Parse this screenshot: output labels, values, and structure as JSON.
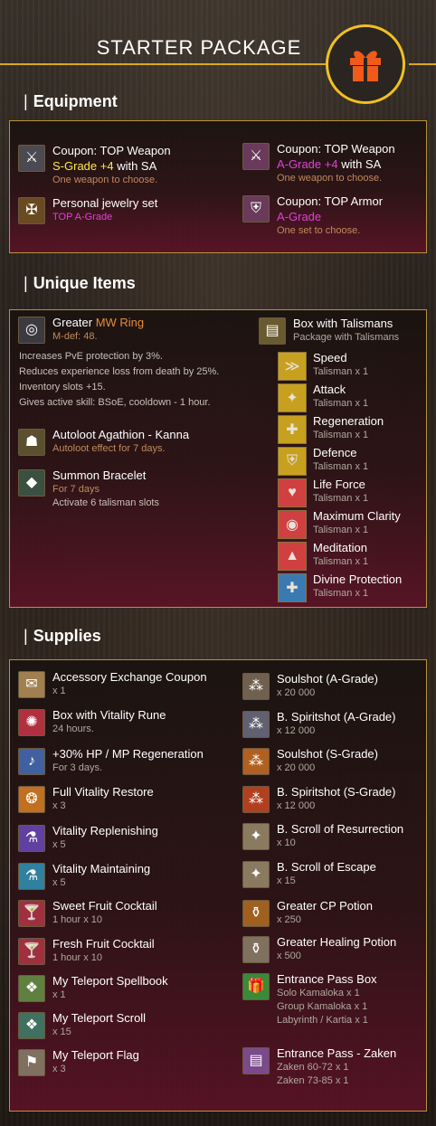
{
  "header": {
    "title": "STARTER PACKAGE"
  },
  "sections": {
    "equipment": "Equipment",
    "unique": "Unique Items",
    "supplies": "Supplies"
  },
  "equipment": [
    {
      "name": "Coupon: TOP Weapon",
      "grade": "S-Grade +4",
      "grade_suffix": " with SA",
      "note": "One weapon to choose.",
      "icon": "weapon-coupon-icon"
    },
    {
      "name": "Coupon: TOP Weapon",
      "grade": "A-Grade +4",
      "grade_suffix": " with SA",
      "note": "One weapon to choose.",
      "icon": "weapon-coupon-icon"
    },
    {
      "name": "Personal jewelry set",
      "grade": "TOP A-Grade",
      "icon": "jewelry-icon"
    },
    {
      "name": "Coupon: TOP Armor",
      "grade": "A-Grade",
      "note": "One set to choose.",
      "icon": "armor-coupon-icon"
    }
  ],
  "unique": {
    "ring": {
      "name": "Greater ",
      "name_hl": "MW Ring",
      "mdef": "M-def: 48.",
      "desc": [
        "Increases PvE protection by 3%.",
        "Reduces experience loss from death by 25%.",
        "Inventory slots +15.",
        "Gives active skill: BSoE, cooldown - 1 hour."
      ]
    },
    "agathion": {
      "name": "Autoloot Agathion - Kanna",
      "note": "Autoloot effect for 7 days."
    },
    "bracelet": {
      "name": "Summon Bracelet",
      "note": "For 7 days",
      "sub": "Activate 6 talisman slots"
    },
    "box": {
      "name": "Box with Talismans",
      "sub": "Package with Talismans"
    },
    "talismans": [
      {
        "name": "Speed",
        "qty": "Talisman x 1",
        "color": "#c8a020",
        "glyph": "≫"
      },
      {
        "name": "Attack",
        "qty": "Talisman x 1",
        "color": "#c8a020",
        "glyph": "✦"
      },
      {
        "name": "Regeneration",
        "qty": "Talisman x 1",
        "color": "#c8a020",
        "glyph": "✚"
      },
      {
        "name": "Defence",
        "qty": "Talisman x 1",
        "color": "#c8a020",
        "glyph": "⛨"
      },
      {
        "name": "Life Force",
        "qty": "Talisman x 1",
        "color": "#d04040",
        "glyph": "♥"
      },
      {
        "name": "Maximum Clarity",
        "qty": "Talisman x 1",
        "color": "#d04040",
        "glyph": "◉"
      },
      {
        "name": "Meditation",
        "qty": "Talisman x 1",
        "color": "#d04040",
        "glyph": "▲"
      },
      {
        "name": "Divine Protection",
        "qty": "Talisman x 1",
        "color": "#3a7ab0",
        "glyph": "✚"
      }
    ]
  },
  "supplies_left": [
    {
      "name": "Accessory Exchange Coupon",
      "qty": "x 1",
      "icon": "scroll-icon",
      "glyph": "✉",
      "color": "#a08050"
    },
    {
      "name": "Box with Vitality Rune",
      "qty": "24 hours.",
      "icon": "rune-icon",
      "glyph": "✺",
      "color": "#b03040"
    },
    {
      "name": "+30% HP / MP Regeneration",
      "qty": "For 3 days.",
      "icon": "regen-icon",
      "glyph": "♪",
      "color": "#4060a0"
    },
    {
      "name": "Full Vitality Restore",
      "qty": "x 3",
      "icon": "restore-icon",
      "glyph": "❂",
      "color": "#c07020"
    },
    {
      "name": "Vitality Replenishing",
      "qty": "x 5",
      "icon": "potion-icon",
      "glyph": "⚗",
      "color": "#6040a0"
    },
    {
      "name": "Vitality Maintaining",
      "qty": "x 5",
      "icon": "potion-icon",
      "glyph": "⚗",
      "color": "#3080a0"
    },
    {
      "name": "Sweet Fruit Cocktail",
      "qty": "1 hour x 10",
      "icon": "cocktail-icon",
      "glyph": "🍸",
      "color": "#a03040"
    },
    {
      "name": "Fresh Fruit Cocktail",
      "qty": "1 hour x 10",
      "icon": "cocktail-icon",
      "glyph": "🍸",
      "color": "#a03040"
    },
    {
      "name": "My Teleport Spellbook",
      "qty": "x 1",
      "icon": "spellbook-icon",
      "glyph": "❖",
      "color": "#608040"
    },
    {
      "name": "My Teleport Scroll",
      "qty": "x 15",
      "icon": "teleport-scroll-icon",
      "glyph": "❖",
      "color": "#407060"
    },
    {
      "name": "My Teleport Flag",
      "qty": "x 3",
      "icon": "flag-icon",
      "glyph": "⚑",
      "color": "#807060"
    }
  ],
  "supplies_right": [
    {
      "name": "Soulshot (A-Grade)",
      "qty": "x 20 000",
      "icon": "soulshot-icon",
      "glyph": "⁂",
      "color": "#706050"
    },
    {
      "name": "B. Spiritshot (A-Grade)",
      "qty": "x 12 000",
      "icon": "spiritshot-icon",
      "glyph": "⁂",
      "color": "#606070"
    },
    {
      "name": "Soulshot (S-Grade)",
      "qty": "x 20 000",
      "icon": "soulshot-icon",
      "glyph": "⁂",
      "color": "#b06020"
    },
    {
      "name": "B. Spiritshot (S-Grade)",
      "qty": "x 12 000",
      "icon": "spiritshot-icon",
      "glyph": "⁂",
      "color": "#b04020"
    },
    {
      "name": "B. Scroll of Resurrection",
      "qty": "x 10",
      "icon": "resurrection-scroll-icon",
      "glyph": "✦",
      "color": "#8a7a60"
    },
    {
      "name": "B. Scroll of Escape",
      "qty": "x 15",
      "icon": "escape-scroll-icon",
      "glyph": "✦",
      "color": "#8a7a60"
    },
    {
      "name": "Greater CP Potion",
      "qty": "x 250",
      "icon": "cp-potion-icon",
      "glyph": "⚱",
      "color": "#a06020"
    },
    {
      "name": "Greater Healing Potion",
      "qty": "x 500",
      "icon": "healing-potion-icon",
      "glyph": "⚱",
      "color": "#807060"
    },
    {
      "name": "Entrance Pass Box",
      "qty": "Solo Kamaloka x 1",
      "qty2": "Group Kamaloka x 1",
      "qty3": "Labyrinth / Kartia x 1",
      "icon": "gift-box-icon",
      "glyph": "🎁",
      "color": "#3a8a3a"
    },
    {
      "name": "Entrance Pass - Zaken",
      "qty": "Zaken 60-72 x 1",
      "qty2": "Zaken 73-85 x 1",
      "icon": "chest-icon",
      "glyph": "▤",
      "color": "#7a4a8a"
    }
  ]
}
